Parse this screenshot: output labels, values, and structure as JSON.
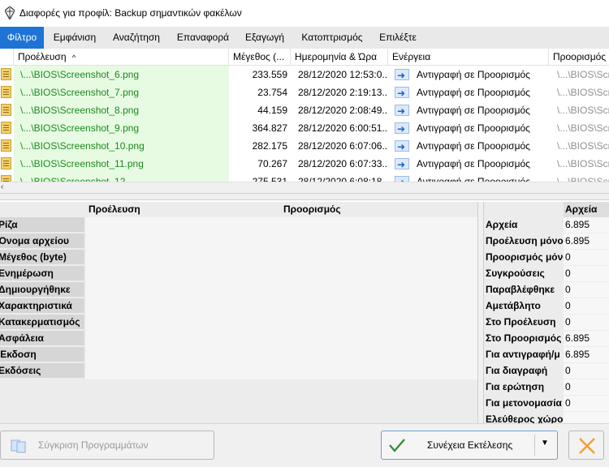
{
  "window": {
    "title": "Διαφορές για προφίλ: Backup σημαντικών φακέλων",
    "icon": "app-logo-icon"
  },
  "menu": [
    {
      "label": "Φίλτρο",
      "active": true
    },
    {
      "label": "Εμφάνιση"
    },
    {
      "label": "Αναζήτηση"
    },
    {
      "label": "Επαναφορά"
    },
    {
      "label": "Εξαγωγή"
    },
    {
      "label": "Κατοπτρισμός"
    },
    {
      "label": "Επιλέξτε"
    }
  ],
  "file_list": {
    "columns": {
      "source": "Προέλευση",
      "size": "Μέγεθος (...",
      "date": "Ημερομηνία & Ώρα",
      "action": "Ενέργεια",
      "destination": "Προορισμός"
    },
    "sort_indicator": "^",
    "rows": [
      {
        "source": "\\...\\BIOS\\Screenshot_6.png",
        "size": "233.559",
        "date": "28/12/2020 12:53:0...",
        "action": "Αντιγραφή σε Προορισμός",
        "destination": "\\...\\BIOS\\Scr"
      },
      {
        "source": "\\...\\BIOS\\Screenshot_7.png",
        "size": "23.754",
        "date": "28/12/2020 2:19:13...",
        "action": "Αντιγραφή σε Προορισμός",
        "destination": "\\...\\BIOS\\Scr"
      },
      {
        "source": "\\...\\BIOS\\Screenshot_8.png",
        "size": "44.159",
        "date": "28/12/2020 2:08:49...",
        "action": "Αντιγραφή σε Προορισμός",
        "destination": "\\...\\BIOS\\Scr"
      },
      {
        "source": "\\...\\BIOS\\Screenshot_9.png",
        "size": "364.827",
        "date": "28/12/2020 6:00:51...",
        "action": "Αντιγραφή σε Προορισμός",
        "destination": "\\...\\BIOS\\Scr"
      },
      {
        "source": "\\...\\BIOS\\Screenshot_10.png",
        "size": "282.175",
        "date": "28/12/2020 6:07:06...",
        "action": "Αντιγραφή σε Προορισμός",
        "destination": "\\...\\BIOS\\Scr"
      },
      {
        "source": "\\...\\BIOS\\Screenshot_11.png",
        "size": "70.267",
        "date": "28/12/2020 6:07:33...",
        "action": "Αντιγραφή σε Προορισμός",
        "destination": "\\...\\BIOS\\Scr"
      },
      {
        "source": "\\...\\BIOS\\Screenshot_12...",
        "size": "275.531",
        "date": "28/12/2020 6:08:18...",
        "action": "Αντιγραφή σε Προορισμός",
        "destination": "\\...\\BIOS\\Scr"
      }
    ]
  },
  "details": {
    "header_source": "Προέλευση",
    "header_destination": "Προορισμός",
    "labels": [
      "Ρίζα",
      "Όνομα αρχείου",
      "Μέγεθος (byte)",
      "Ενημέρωση",
      "Δημιουργήθηκε",
      "Χαρακτηριστικά",
      "Κατακερματισμός",
      "Ασφάλεια",
      "Έκδοση",
      "Εκδόσεις"
    ]
  },
  "stats": {
    "header": "Αρχεία",
    "rows": [
      {
        "label": "Αρχεία",
        "value": "6.895"
      },
      {
        "label": "Προέλευση μόνο",
        "value": "6.895"
      },
      {
        "label": "Προορισμός μόνο",
        "value": "0"
      },
      {
        "label": "Συγκρούσεις",
        "value": "0"
      },
      {
        "label": "Παραβλέφθηκε",
        "value": "0"
      },
      {
        "label": "Αμετάβλητο",
        "value": "0"
      },
      {
        "label": "Στο Προέλευση",
        "value": "0"
      },
      {
        "label": "Στο Προορισμός",
        "value": "6.895"
      },
      {
        "label": "Για αντιγραφή/μ",
        "value": "6.895"
      },
      {
        "label": "Για διαγραφή",
        "value": "0"
      },
      {
        "label": "Για ερώτηση",
        "value": "0"
      },
      {
        "label": "Για μετονομασία",
        "value": "0"
      },
      {
        "label": "Ελεύθερος χώρος",
        "value": ""
      }
    ]
  },
  "buttons": {
    "compare": "Σύγκριση Προγραμμάτων",
    "continue": "Συνέχεια Εκτέλεσης",
    "cancel_icon": "close-x-icon"
  },
  "colors": {
    "accent": "#1e74d4",
    "source_highlight": "#e7fbe3",
    "source_text": "#1c8a1c",
    "check_green": "#2e8b2e",
    "cancel_orange": "#f0a030"
  }
}
